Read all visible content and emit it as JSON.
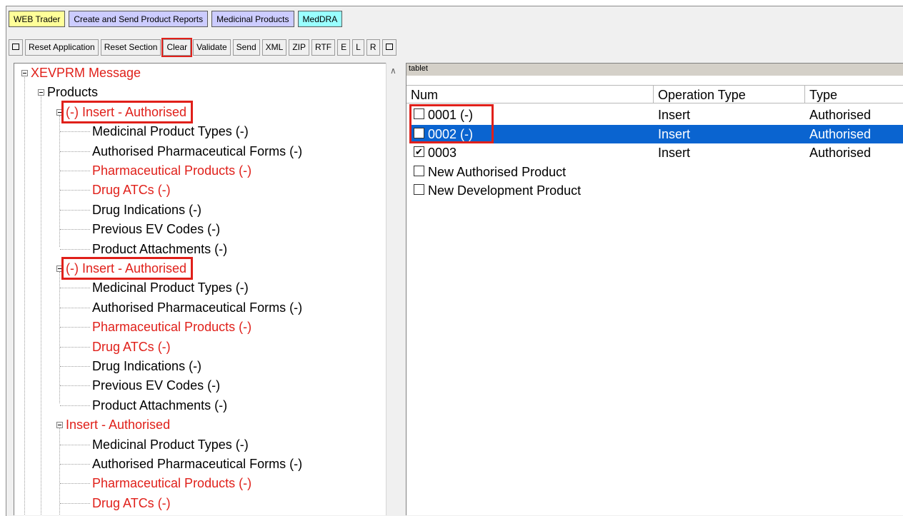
{
  "tabs": [
    {
      "label": "WEB Trader",
      "color": "#ffff99"
    },
    {
      "label": "Create and Send Product Reports",
      "color": "#ccccff"
    },
    {
      "label": "Medicinal Products",
      "color": "#ccccff"
    },
    {
      "label": "MedDRA",
      "color": "#99ffff"
    }
  ],
  "toolbar": {
    "reset_application": "Reset Application",
    "reset_section": "Reset Section",
    "clear": "Clear",
    "validate": "Validate",
    "send": "Send",
    "xml": "XML",
    "zip": "ZIP",
    "rtf": "RTF",
    "e": "E",
    "l": "L",
    "r": "R"
  },
  "tree": {
    "root": "XEVPRM Message",
    "products": "Products",
    "groups": [
      {
        "label": "(-) Insert - Authorised",
        "children": [
          {
            "label": "Medicinal Product Types (-)",
            "red": false
          },
          {
            "label": "Authorised Pharmaceutical Forms (-)",
            "red": false
          },
          {
            "label": "Pharmaceutical Products (-)",
            "red": true
          },
          {
            "label": "Drug ATCs (-)",
            "red": true
          },
          {
            "label": "Drug Indications (-)",
            "red": false
          },
          {
            "label": "Previous EV Codes (-)",
            "red": false
          },
          {
            "label": "Product Attachments (-)",
            "red": false
          }
        ]
      },
      {
        "label": "(-) Insert - Authorised",
        "children": [
          {
            "label": "Medicinal Product Types (-)",
            "red": false
          },
          {
            "label": "Authorised Pharmaceutical Forms (-)",
            "red": false
          },
          {
            "label": "Pharmaceutical Products (-)",
            "red": true
          },
          {
            "label": "Drug ATCs (-)",
            "red": true
          },
          {
            "label": "Drug Indications (-)",
            "red": false
          },
          {
            "label": "Previous EV Codes (-)",
            "red": false
          },
          {
            "label": "Product Attachments (-)",
            "red": false
          }
        ]
      },
      {
        "label": "Insert - Authorised",
        "children": [
          {
            "label": "Medicinal Product Types (-)",
            "red": false
          },
          {
            "label": "Authorised Pharmaceutical Forms (-)",
            "red": false
          },
          {
            "label": "Pharmaceutical Products (-)",
            "red": true
          },
          {
            "label": "Drug ATCs (-)",
            "red": true
          },
          {
            "label": "Drug Indications (-)",
            "red": false
          }
        ]
      }
    ]
  },
  "right": {
    "label_strip": "tablet",
    "columns": [
      "Num",
      "Operation Type",
      "Type"
    ],
    "rows": [
      {
        "num": "0001 (-)",
        "op": "Insert",
        "type": "Authorised",
        "checked": false,
        "selected": false
      },
      {
        "num": "0002 (-)",
        "op": "Insert",
        "type": "Authorised",
        "checked": false,
        "selected": true
      },
      {
        "num": "0003",
        "op": "Insert",
        "type": "Authorised",
        "checked": true,
        "selected": false
      },
      {
        "num": "New Authorised Product",
        "op": "",
        "type": "",
        "checked": false,
        "selected": false
      },
      {
        "num": "New Development Product",
        "op": "",
        "type": "",
        "checked": false,
        "selected": false
      }
    ]
  },
  "colors": {
    "highlight": "#e0201a",
    "selection": "#0a64d0",
    "red_text": "#e0201a"
  }
}
